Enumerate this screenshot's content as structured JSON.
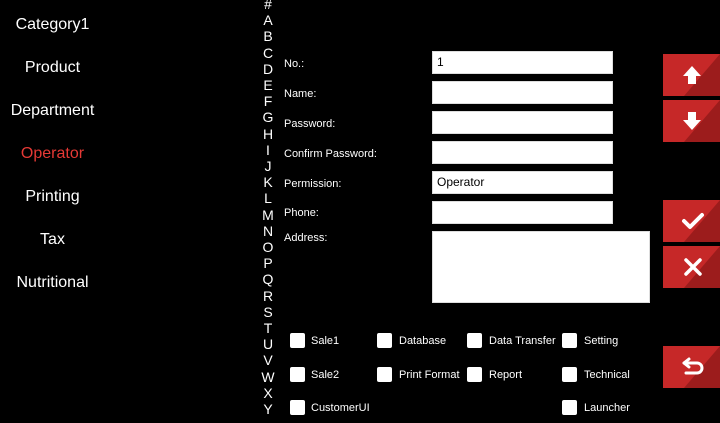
{
  "sidebar": {
    "items": [
      {
        "label": "Category1"
      },
      {
        "label": "Product"
      },
      {
        "label": "Department"
      },
      {
        "label": "Operator"
      },
      {
        "label": "Printing"
      },
      {
        "label": "Tax"
      },
      {
        "label": "Nutritional"
      }
    ],
    "active_color": "#e53935"
  },
  "alphabet": [
    "#",
    "A",
    "B",
    "C",
    "D",
    "E",
    "F",
    "G",
    "H",
    "I",
    "J",
    "K",
    "L",
    "M",
    "N",
    "O",
    "P",
    "Q",
    "R",
    "S",
    "T",
    "U",
    "V",
    "W",
    "X",
    "Y"
  ],
  "form": {
    "no_label": "No.:",
    "no_value": "1",
    "name_label": "Name:",
    "name_value": "",
    "password_label": "Password:",
    "password_value": "",
    "confirm_label": "Confirm Password:",
    "confirm_value": "",
    "permission_label": "Permission:",
    "permission_value": "Operator",
    "phone_label": "Phone:",
    "phone_value": "",
    "address_label": "Address:",
    "address_value": ""
  },
  "permissions": {
    "sale1": "Sale1",
    "database": "Database",
    "data_transfer": "Data Transfer",
    "setting": "Setting",
    "sale2": "Sale2",
    "print_format": "Print Format",
    "report": "Report",
    "technical": "Technical",
    "customer_ui": "CustomerUI",
    "launcher": "Launcher"
  },
  "buttons": {
    "up": "arrow-up-icon",
    "down": "arrow-down-icon",
    "confirm": "checkmark-icon",
    "cancel": "close-icon",
    "back": "return-icon",
    "color": "#c62828"
  }
}
